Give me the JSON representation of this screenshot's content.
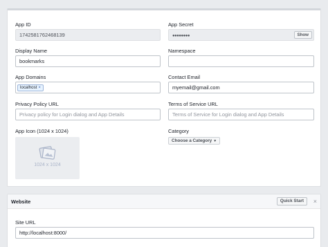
{
  "basic": {
    "app_id": {
      "label": "App ID",
      "value": "1742581762468139"
    },
    "app_secret": {
      "label": "App Secret",
      "value": "●●●●●●●●",
      "show_label": "Show"
    },
    "display_name": {
      "label": "Display Name",
      "value": "bookmarks"
    },
    "namespace": {
      "label": "Namespace",
      "value": ""
    },
    "app_domains": {
      "label": "App Domains",
      "tokens": [
        "localhost"
      ],
      "token_remove": "×"
    },
    "contact_email": {
      "label": "Contact Email",
      "value": "myemail@gmail.com"
    },
    "privacy_url": {
      "label": "Privacy Policy URL",
      "placeholder": "Privacy policy for Login dialog and App Details"
    },
    "tos_url": {
      "label": "Terms of Service URL",
      "placeholder": "Terms of Service for Login dialog and App Details"
    },
    "app_icon": {
      "label": "App Icon (1024 x 1024)",
      "size_text": "1024 x 1024"
    },
    "category": {
      "label": "Category",
      "selected": "Choose a Category"
    }
  },
  "website": {
    "title": "Website",
    "quick_start": "Quick Start",
    "close": "×",
    "site_url": {
      "label": "Site URL",
      "value": "http://localhost:8000/"
    }
  }
}
